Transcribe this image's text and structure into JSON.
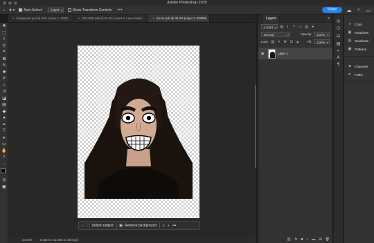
{
  "window": {
    "title": "Adobe Photoshop 2025"
  },
  "options_bar": {
    "auto_select_label": "Auto-Select:",
    "auto_select_value": "Layer",
    "transform_controls_label": "Show Transform Controls",
    "more_label": "•••",
    "share_label": "Share"
  },
  "tabs": [
    {
      "label": "Storyboard.psd @ 50% (Layer 1, RGB/..."
    },
    {
      "label": "ME SIDE.psb @ 33.3% (Layer 0, Layer Mask/..."
    },
    {
      "label": "me s1.psb @ 33.3% (Layer 1, RGB/8)"
    }
  ],
  "context_bar": {
    "select_subject": "Select subject",
    "remove_background": "Remove background",
    "more": "•••"
  },
  "status": {
    "zoom": "33.33%",
    "info": "8.262 in x 11.693 in (300 ppi)"
  },
  "layers_panel": {
    "title": "Layers",
    "filter_value": "Kind",
    "blend_mode": "Normal",
    "opacity_label": "Opacity:",
    "opacity_value": "100%",
    "lock_label": "Lock:",
    "fill_label": "Fill:",
    "fill_value": "100%",
    "layers": [
      {
        "name": "Layer 1",
        "visible": true
      }
    ]
  },
  "right_panel": {
    "groups": [
      [
        "Color",
        "Swatches",
        "Gradients",
        "Patterns"
      ],
      [
        "Channels",
        "Paths"
      ]
    ]
  },
  "colors": {
    "accent": "#2680eb",
    "foreground": "#000000",
    "background": "#ffffff"
  }
}
